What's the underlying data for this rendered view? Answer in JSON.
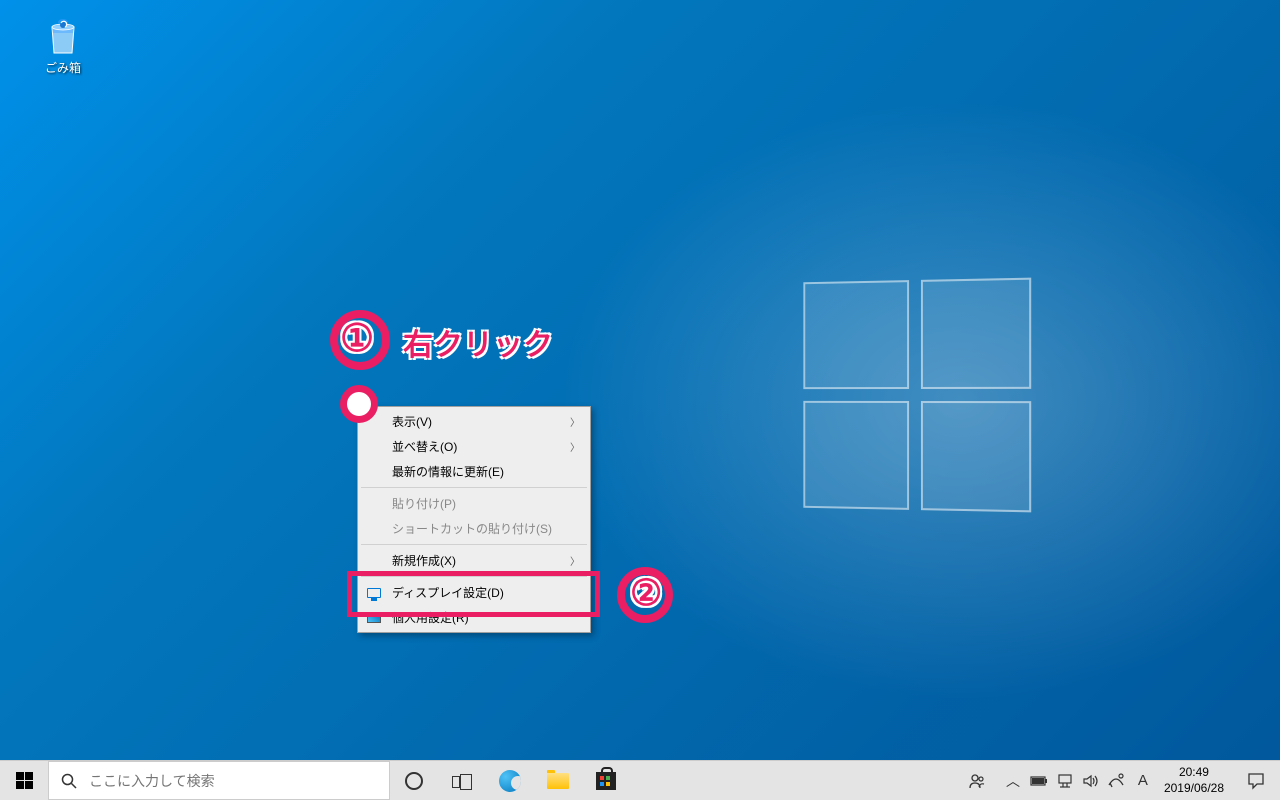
{
  "desktop": {
    "recycle_bin_label": "ごみ箱"
  },
  "context_menu": {
    "items": [
      {
        "label": "表示(V)",
        "has_submenu": true
      },
      {
        "label": "並べ替え(O)",
        "has_submenu": true
      },
      {
        "label": "最新の情報に更新(E)",
        "has_submenu": false
      }
    ],
    "items2": [
      {
        "label": "貼り付け(P)",
        "disabled": true
      },
      {
        "label": "ショートカットの貼り付け(S)",
        "disabled": true
      }
    ],
    "items3": [
      {
        "label": "新規作成(X)",
        "has_submenu": true
      }
    ],
    "items4": [
      {
        "label": "ディスプレイ設定(D)",
        "icon": "monitor"
      },
      {
        "label": "個人用設定(R)",
        "icon": "personalize"
      }
    ]
  },
  "annotations": {
    "number_1": "①",
    "text_1": "右クリック",
    "number_2": "②"
  },
  "taskbar": {
    "search_placeholder": "ここに入力して検索",
    "ime_indicator": "A",
    "clock_time": "20:49",
    "clock_date": "2019/06/28"
  }
}
